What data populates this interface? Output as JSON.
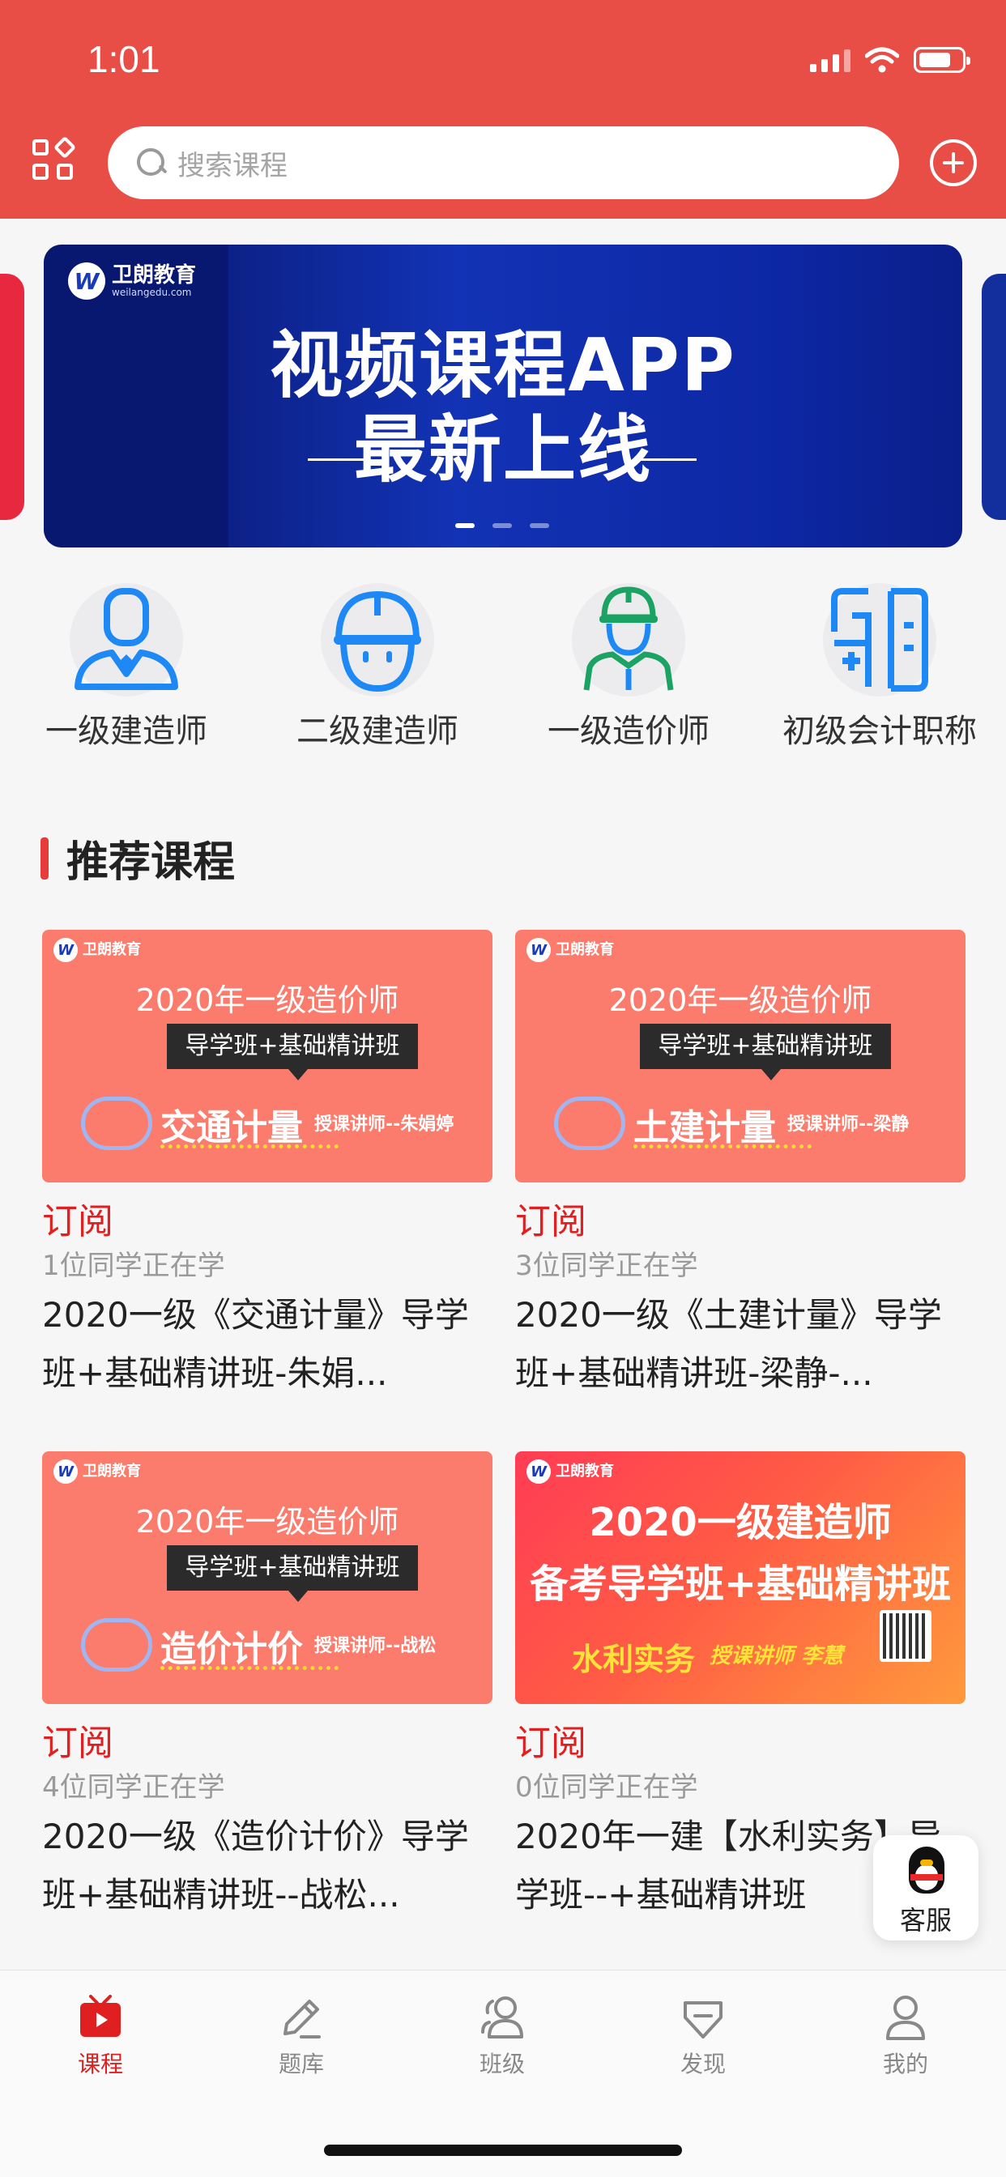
{
  "status_bar": {
    "time": "1:01"
  },
  "header": {
    "search_placeholder": "搜索课程"
  },
  "banner": {
    "logo_text": "卫朗教育",
    "logo_sub": "weilangedu.com",
    "line1": "视频课程APP",
    "line2": "最新上线",
    "slide_count": 3,
    "active_slide": 1
  },
  "categories": [
    {
      "label": "一级建造师",
      "icon": "person-icon"
    },
    {
      "label": "二级建造师",
      "icon": "helmet-icon"
    },
    {
      "label": "一级造价师",
      "icon": "worker-icon"
    },
    {
      "label": "初级会计职称",
      "icon": "accounting-icon"
    }
  ],
  "section": {
    "title": "推荐课程"
  },
  "courses": [
    {
      "thumb_title": "2020年一级造价师",
      "thumb_tag": "导学班+基础精讲班",
      "thumb_subject": "交通计量",
      "thumb_teacher": "授课讲师--朱娟婷",
      "subscribe": "订阅",
      "count": "1位同学正在学",
      "title": "2020一级《交通计量》导学班+基础精讲班-朱娟..."
    },
    {
      "thumb_title": "2020年一级造价师",
      "thumb_tag": "导学班+基础精讲班",
      "thumb_subject": "土建计量",
      "thumb_teacher": "授课讲师--梁静",
      "subscribe": "订阅",
      "count": "3位同学正在学",
      "title": "2020一级《土建计量》导学班+基础精讲班-梁静-..."
    },
    {
      "thumb_title": "2020年一级造价师",
      "thumb_tag": "导学班+基础精讲班",
      "thumb_subject": "造价计价",
      "thumb_teacher": "授课讲师--战松",
      "subscribe": "订阅",
      "count": "4位同学正在学",
      "title": "2020一级《造价计价》导学班+基础精讲班--战松..."
    },
    {
      "thumb_title": "2020一级建造师",
      "thumb_tag": "备考导学班+基础精讲班",
      "thumb_subject": "水利实务",
      "thumb_teacher": "授课讲师 李慧",
      "subscribe": "订阅",
      "count": "0位同学正在学",
      "title": "2020年一建【水利实务】导学班--+基础精讲班"
    }
  ],
  "service": {
    "label": "客服"
  },
  "tabbar": {
    "items": [
      {
        "label": "课程",
        "icon": "video-icon",
        "active": true
      },
      {
        "label": "题库",
        "icon": "pencil-icon",
        "active": false
      },
      {
        "label": "班级",
        "icon": "group-icon",
        "active": false
      },
      {
        "label": "发现",
        "icon": "discover-icon",
        "active": false
      },
      {
        "label": "我的",
        "icon": "profile-icon",
        "active": false
      }
    ]
  },
  "colors": {
    "brand_red": "#e84d46",
    "accent_red": "#e02020",
    "banner_blue": "#1233b5",
    "thumb_salmon": "#fb7c6d",
    "icon_blue": "#1e88f5",
    "icon_green": "#1aa363"
  }
}
